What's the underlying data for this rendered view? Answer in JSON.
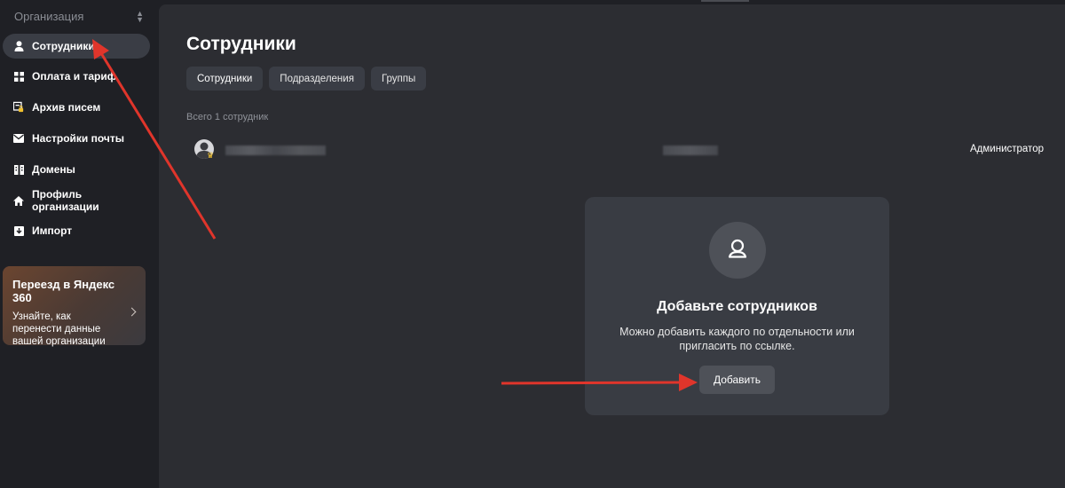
{
  "sidebar": {
    "org_label": "Организация",
    "items": [
      {
        "label": "Сотрудники",
        "icon": "person-icon",
        "active": true
      },
      {
        "label": "Оплата и тариф",
        "icon": "grid-icon",
        "active": false
      },
      {
        "label": "Архив писем",
        "icon": "archive-lock-icon",
        "active": false
      },
      {
        "label": "Настройки почты",
        "icon": "mail-icon",
        "active": false
      },
      {
        "label": "Домены",
        "icon": "domains-icon",
        "active": false
      },
      {
        "label": "Профиль организации",
        "icon": "home-icon",
        "active": false
      },
      {
        "label": "Импорт",
        "icon": "import-icon",
        "active": false
      }
    ],
    "promo": {
      "title": "Переезд в Яндекс 360",
      "text": "Узнайте, как перенести данные вашей организации"
    }
  },
  "main": {
    "title": "Сотрудники",
    "tabs": [
      {
        "label": "Сотрудники",
        "selected": true
      },
      {
        "label": "Подразделения",
        "selected": false
      },
      {
        "label": "Группы",
        "selected": false
      }
    ],
    "count_text": "Всего 1 сотрудник",
    "employees": [
      {
        "role": "Администратор",
        "is_admin": true
      }
    ],
    "empty_state": {
      "title": "Добавьте сотрудников",
      "description": "Можно добавить каждого по отдельности или пригласить по ссылке.",
      "button_label": "Добавить"
    }
  },
  "colors": {
    "background": "#1f2025",
    "panel": "#2c2d32",
    "card": "#393c43",
    "annotation_arrow": "#e0352b",
    "crown": "#f2c12e"
  }
}
